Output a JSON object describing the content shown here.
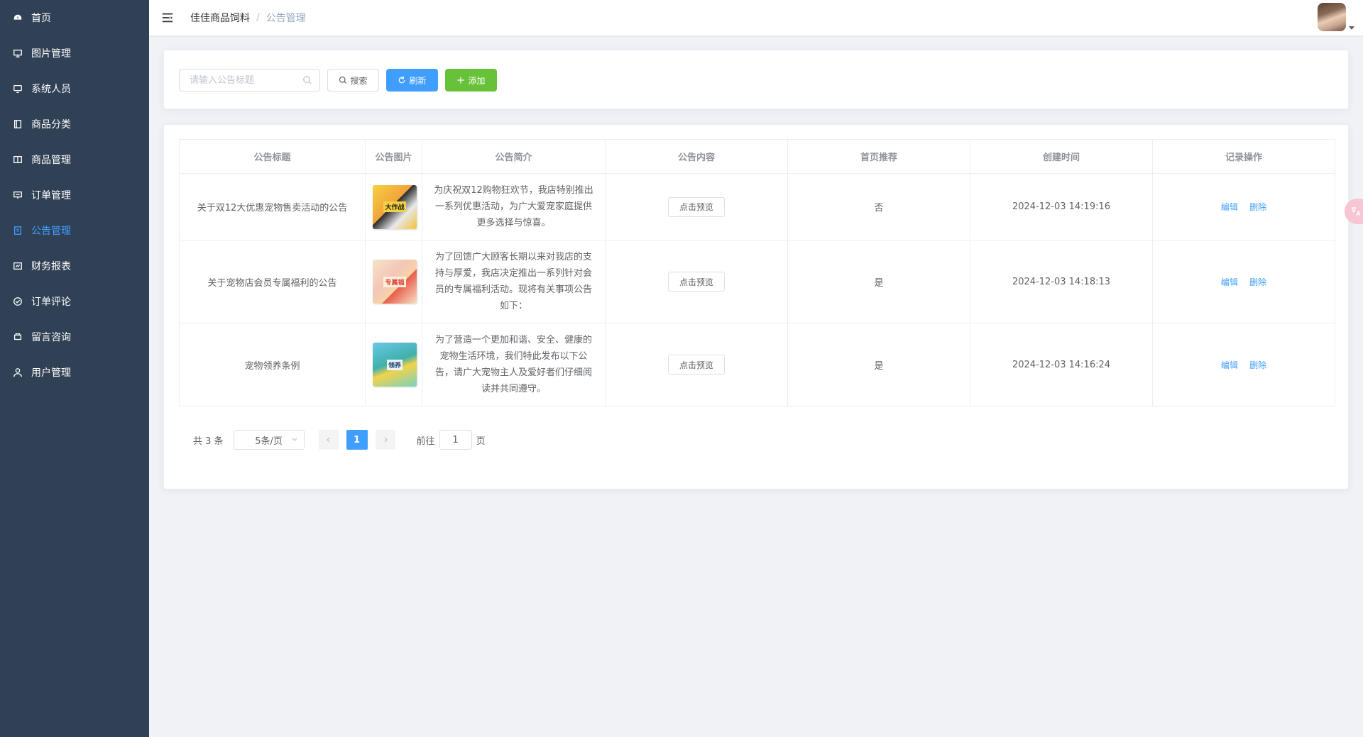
{
  "sidebar": {
    "items": [
      {
        "label": "首页",
        "icon": "dashboard-icon"
      },
      {
        "label": "图片管理",
        "icon": "picture-icon"
      },
      {
        "label": "系统人员",
        "icon": "monitor-icon"
      },
      {
        "label": "商品分类",
        "icon": "folder-icon"
      },
      {
        "label": "商品管理",
        "icon": "book-icon"
      },
      {
        "label": "订单管理",
        "icon": "order-icon"
      },
      {
        "label": "公告管理",
        "icon": "document-icon",
        "active": true
      },
      {
        "label": "财务报表",
        "icon": "report-icon"
      },
      {
        "label": "订单评论",
        "icon": "comment-icon"
      },
      {
        "label": "留言咨询",
        "icon": "message-icon"
      },
      {
        "label": "用户管理",
        "icon": "user-icon"
      }
    ],
    "active_color": "#409eff",
    "bg_color": "#304156"
  },
  "header": {
    "breadcrumb_home": "佳佳商品饲料",
    "breadcrumb_sep": "/",
    "breadcrumb_current": "公告管理"
  },
  "search": {
    "placeholder": "请输入公告标题",
    "search_label": "搜索",
    "refresh_label": "刷新",
    "add_label": "添加"
  },
  "table": {
    "columns": [
      "公告标题",
      "公告图片",
      "公告简介",
      "公告内容",
      "首页推荐",
      "创建时间",
      "记录操作"
    ],
    "rows": [
      {
        "title": "关于双12大优惠宠物售卖活动的公告",
        "image_caption": "大作战",
        "desc": "为庆祝双12购物狂欢节，我店特别推出一系列优惠活动，为广大爱宠家庭提供更多选择与惊喜。",
        "content_button": "点击预览",
        "recommend": "否",
        "created": "2024-12-03 14:19:16",
        "edit": "编辑",
        "delete": "删除"
      },
      {
        "title": "关于宠物店会员专属福利的公告",
        "image_caption": "专属福",
        "desc": "为了回馈广大顾客长期以来对我店的支持与厚爱，我店决定推出一系列针对会员的专属福利活动。现将有关事项公告如下：",
        "content_button": "点击预览",
        "recommend": "是",
        "created": "2024-12-03 14:18:13",
        "edit": "编辑",
        "delete": "删除"
      },
      {
        "title": "宠物领养条例",
        "image_caption": "领养",
        "desc": "为了营造一个更加和谐、安全、健康的宠物生活环境，我们特此发布以下公告，请广大宠物主人及爱好者们仔细阅读并共同遵守。",
        "content_button": "点击预览",
        "recommend": "是",
        "created": "2024-12-03 14:16:24",
        "edit": "编辑",
        "delete": "删除"
      }
    ]
  },
  "pagination": {
    "total": "共 3 条",
    "page_size": "5条/页",
    "current_page": "1",
    "goto_prefix": "前往",
    "goto_value": "1",
    "goto_suffix": "页"
  },
  "colors": {
    "primary": "#409eff",
    "success": "#67c23a"
  }
}
